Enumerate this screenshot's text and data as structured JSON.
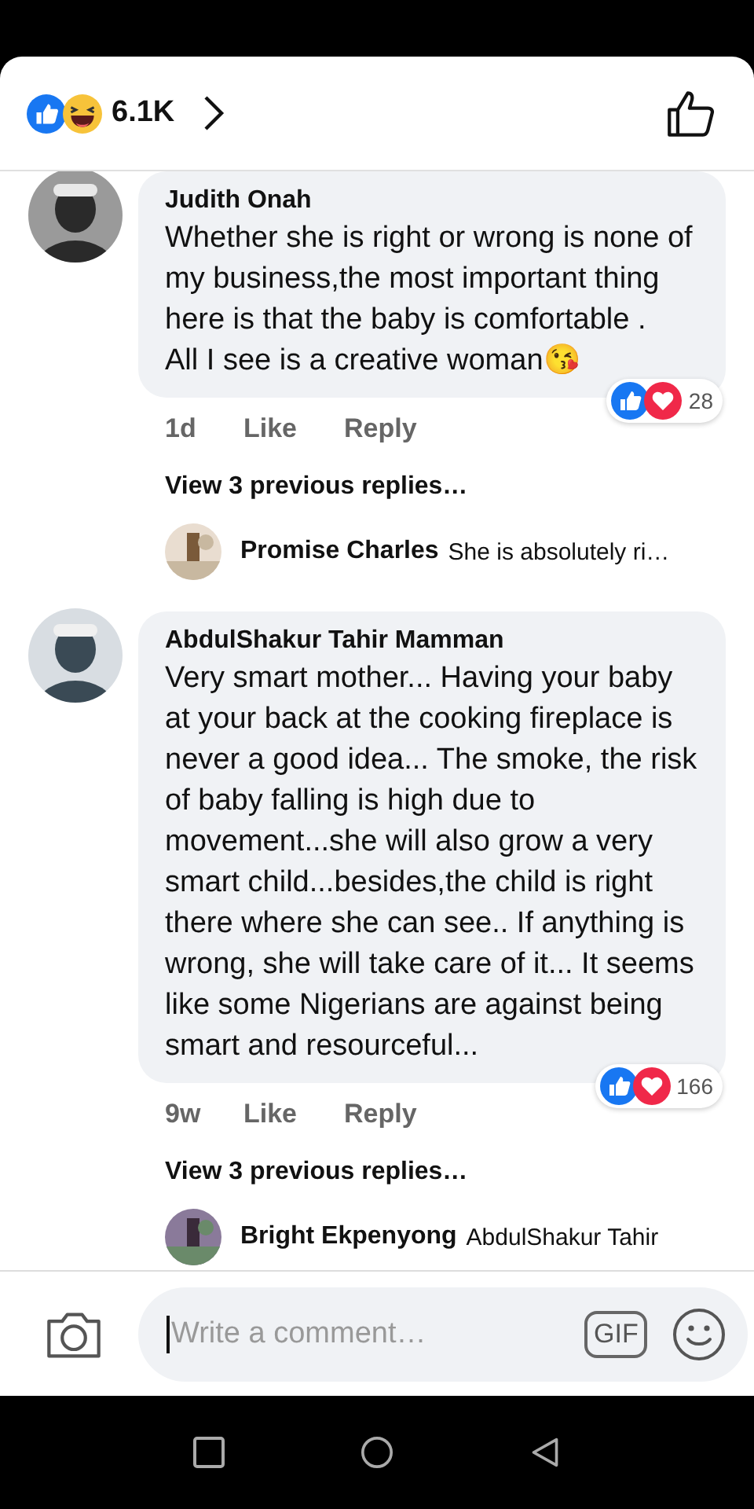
{
  "header": {
    "reaction_count": "6.1K"
  },
  "comments": [
    {
      "author": "Judith Onah",
      "text": "Whether she is right or wrong is none of my business,the most important thing here is that the baby is comfortable .\nAll I see is a creative woman😘",
      "time": "1d",
      "actions": [
        "Like",
        "Reply"
      ],
      "reaction_count": "28",
      "view_replies": "View 3 previous replies…",
      "reply": {
        "author": "Promise Charles",
        "text": "She is absolutely ri…"
      }
    },
    {
      "author": "AbdulShakur Tahir Mamman",
      "text": "Very smart mother... Having your baby at your back at the cooking fireplace is never a good idea... The smoke, the risk of baby falling is high due to movement...she will also grow a very smart child...besides,the child is right there where she can see.. If anything is wrong, she  will take care of it... It seems like some Nigerians are against being smart and resourceful...",
      "time": "9w",
      "actions": [
        "Like",
        "Reply"
      ],
      "reaction_count": "166",
      "view_replies": "View 3 previous replies…",
      "reply": {
        "author": "Bright Ekpenyong",
        "text": "AbdulShakur Tahir"
      }
    }
  ],
  "composer": {
    "placeholder": "Write a comment…",
    "gif_label": "GIF"
  }
}
